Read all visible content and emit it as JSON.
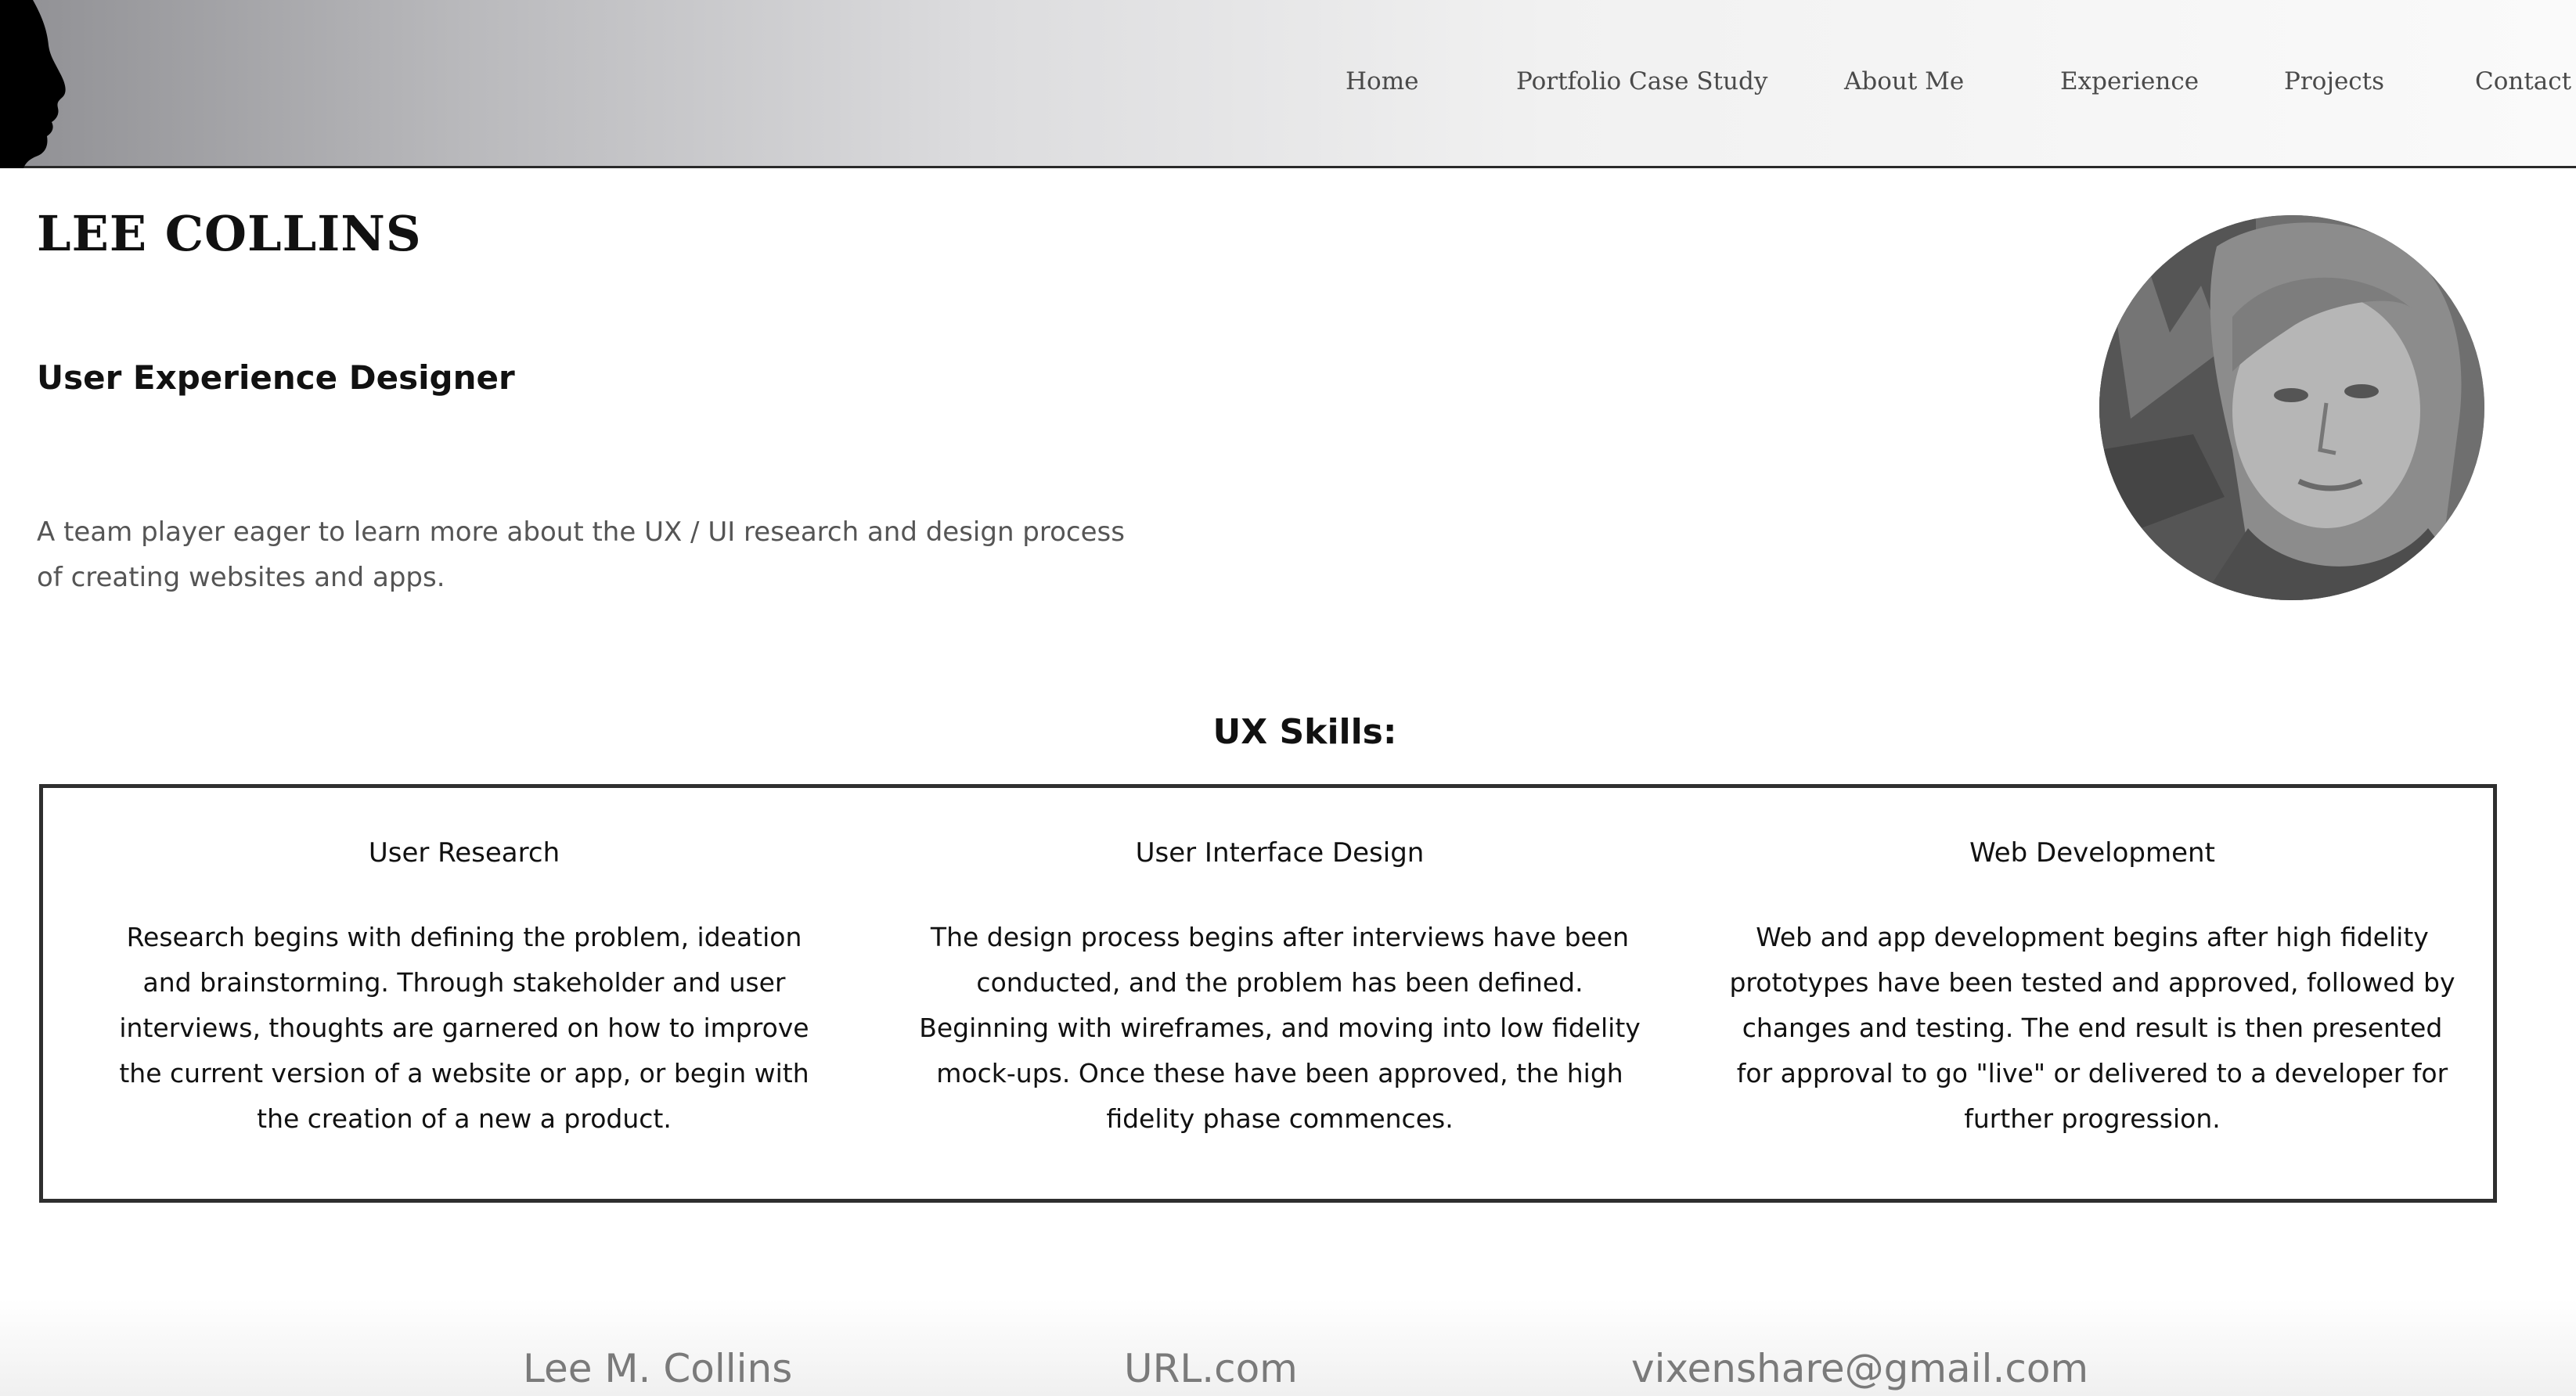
{
  "nav": {
    "home": "Home",
    "portfolio": "Portfolio Case Study",
    "about": "About Me",
    "experience": "Experience",
    "projects": "Projects",
    "contact": "Contact"
  },
  "profile": {
    "name": "LEE COLLINS",
    "role": "User Experience Designer",
    "intro": "A team player eager to learn more about the UX / UI research and design process of creating websites and apps."
  },
  "skills": {
    "title": "UX Skills:",
    "items": [
      {
        "heading": "User Research",
        "body": "Research begins with defining the problem, ideation and brainstorming. Through stakeholder and user interviews, thoughts are garnered on how to improve the current version of a website or app, or begin with the creation of a new a product."
      },
      {
        "heading": "User Interface Design",
        "body": "The design process begins after interviews have been conducted, and the problem has been defined. Beginning with wireframes, and moving into low fidelity mock-ups. Once these have been approved, the high fidelity phase commences."
      },
      {
        "heading": "Web Development",
        "body": "Web and app development begins after high fidelity prototypes have been tested and approved, followed by changes and testing. The end result is then presented for approval to go \"live\" or delivered to a developer for further progression."
      }
    ]
  },
  "footer": {
    "name": "Lee M. Collins",
    "url": "URL.com",
    "email": "vixenshare@gmail.com"
  },
  "icons": {
    "logo": "head-silhouette-icon",
    "avatar": "profile-photo"
  }
}
